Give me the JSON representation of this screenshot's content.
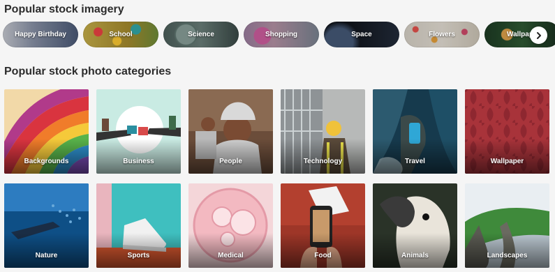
{
  "sections": {
    "popular_imagery_title": "Popular stock imagery",
    "categories_title": "Popular stock photo categories"
  },
  "imagery_pills": [
    {
      "label": "Happy Birthday"
    },
    {
      "label": "School"
    },
    {
      "label": "Science"
    },
    {
      "label": "Shopping"
    },
    {
      "label": "Space"
    },
    {
      "label": "Flowers"
    },
    {
      "label": "Wallpaper"
    }
  ],
  "categories": [
    {
      "label": "Backgrounds"
    },
    {
      "label": "Business"
    },
    {
      "label": "People"
    },
    {
      "label": "Technology"
    },
    {
      "label": "Travel"
    },
    {
      "label": "Wallpaper"
    },
    {
      "label": "Nature"
    },
    {
      "label": "Sports"
    },
    {
      "label": "Medical"
    },
    {
      "label": "Food"
    },
    {
      "label": "Animals"
    },
    {
      "label": "Landscapes"
    }
  ],
  "icons": {
    "next": "chevron-right-icon"
  }
}
